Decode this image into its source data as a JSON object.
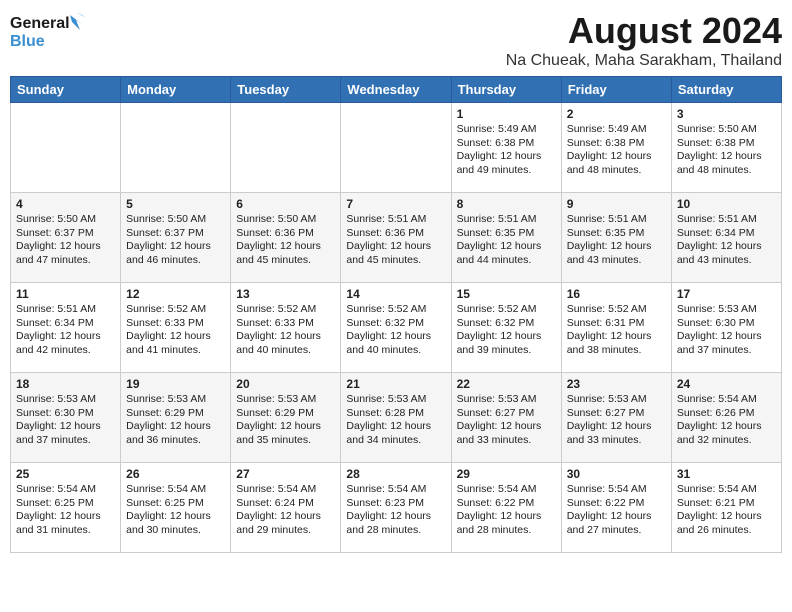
{
  "logo": {
    "line1": "General",
    "line2": "Blue"
  },
  "title": "August 2024",
  "subtitle": "Na Chueak, Maha Sarakham, Thailand",
  "days_of_week": [
    "Sunday",
    "Monday",
    "Tuesday",
    "Wednesday",
    "Thursday",
    "Friday",
    "Saturday"
  ],
  "weeks": [
    [
      {
        "day": "",
        "info": ""
      },
      {
        "day": "",
        "info": ""
      },
      {
        "day": "",
        "info": ""
      },
      {
        "day": "",
        "info": ""
      },
      {
        "day": "1",
        "info": "Sunrise: 5:49 AM\nSunset: 6:38 PM\nDaylight: 12 hours\nand 49 minutes."
      },
      {
        "day": "2",
        "info": "Sunrise: 5:49 AM\nSunset: 6:38 PM\nDaylight: 12 hours\nand 48 minutes."
      },
      {
        "day": "3",
        "info": "Sunrise: 5:50 AM\nSunset: 6:38 PM\nDaylight: 12 hours\nand 48 minutes."
      }
    ],
    [
      {
        "day": "4",
        "info": "Sunrise: 5:50 AM\nSunset: 6:37 PM\nDaylight: 12 hours\nand 47 minutes."
      },
      {
        "day": "5",
        "info": "Sunrise: 5:50 AM\nSunset: 6:37 PM\nDaylight: 12 hours\nand 46 minutes."
      },
      {
        "day": "6",
        "info": "Sunrise: 5:50 AM\nSunset: 6:36 PM\nDaylight: 12 hours\nand 45 minutes."
      },
      {
        "day": "7",
        "info": "Sunrise: 5:51 AM\nSunset: 6:36 PM\nDaylight: 12 hours\nand 45 minutes."
      },
      {
        "day": "8",
        "info": "Sunrise: 5:51 AM\nSunset: 6:35 PM\nDaylight: 12 hours\nand 44 minutes."
      },
      {
        "day": "9",
        "info": "Sunrise: 5:51 AM\nSunset: 6:35 PM\nDaylight: 12 hours\nand 43 minutes."
      },
      {
        "day": "10",
        "info": "Sunrise: 5:51 AM\nSunset: 6:34 PM\nDaylight: 12 hours\nand 43 minutes."
      }
    ],
    [
      {
        "day": "11",
        "info": "Sunrise: 5:51 AM\nSunset: 6:34 PM\nDaylight: 12 hours\nand 42 minutes."
      },
      {
        "day": "12",
        "info": "Sunrise: 5:52 AM\nSunset: 6:33 PM\nDaylight: 12 hours\nand 41 minutes."
      },
      {
        "day": "13",
        "info": "Sunrise: 5:52 AM\nSunset: 6:33 PM\nDaylight: 12 hours\nand 40 minutes."
      },
      {
        "day": "14",
        "info": "Sunrise: 5:52 AM\nSunset: 6:32 PM\nDaylight: 12 hours\nand 40 minutes."
      },
      {
        "day": "15",
        "info": "Sunrise: 5:52 AM\nSunset: 6:32 PM\nDaylight: 12 hours\nand 39 minutes."
      },
      {
        "day": "16",
        "info": "Sunrise: 5:52 AM\nSunset: 6:31 PM\nDaylight: 12 hours\nand 38 minutes."
      },
      {
        "day": "17",
        "info": "Sunrise: 5:53 AM\nSunset: 6:30 PM\nDaylight: 12 hours\nand 37 minutes."
      }
    ],
    [
      {
        "day": "18",
        "info": "Sunrise: 5:53 AM\nSunset: 6:30 PM\nDaylight: 12 hours\nand 37 minutes."
      },
      {
        "day": "19",
        "info": "Sunrise: 5:53 AM\nSunset: 6:29 PM\nDaylight: 12 hours\nand 36 minutes."
      },
      {
        "day": "20",
        "info": "Sunrise: 5:53 AM\nSunset: 6:29 PM\nDaylight: 12 hours\nand 35 minutes."
      },
      {
        "day": "21",
        "info": "Sunrise: 5:53 AM\nSunset: 6:28 PM\nDaylight: 12 hours\nand 34 minutes."
      },
      {
        "day": "22",
        "info": "Sunrise: 5:53 AM\nSunset: 6:27 PM\nDaylight: 12 hours\nand 33 minutes."
      },
      {
        "day": "23",
        "info": "Sunrise: 5:53 AM\nSunset: 6:27 PM\nDaylight: 12 hours\nand 33 minutes."
      },
      {
        "day": "24",
        "info": "Sunrise: 5:54 AM\nSunset: 6:26 PM\nDaylight: 12 hours\nand 32 minutes."
      }
    ],
    [
      {
        "day": "25",
        "info": "Sunrise: 5:54 AM\nSunset: 6:25 PM\nDaylight: 12 hours\nand 31 minutes."
      },
      {
        "day": "26",
        "info": "Sunrise: 5:54 AM\nSunset: 6:25 PM\nDaylight: 12 hours\nand 30 minutes."
      },
      {
        "day": "27",
        "info": "Sunrise: 5:54 AM\nSunset: 6:24 PM\nDaylight: 12 hours\nand 29 minutes."
      },
      {
        "day": "28",
        "info": "Sunrise: 5:54 AM\nSunset: 6:23 PM\nDaylight: 12 hours\nand 28 minutes."
      },
      {
        "day": "29",
        "info": "Sunrise: 5:54 AM\nSunset: 6:22 PM\nDaylight: 12 hours\nand 28 minutes."
      },
      {
        "day": "30",
        "info": "Sunrise: 5:54 AM\nSunset: 6:22 PM\nDaylight: 12 hours\nand 27 minutes."
      },
      {
        "day": "31",
        "info": "Sunrise: 5:54 AM\nSunset: 6:21 PM\nDaylight: 12 hours\nand 26 minutes."
      }
    ]
  ]
}
